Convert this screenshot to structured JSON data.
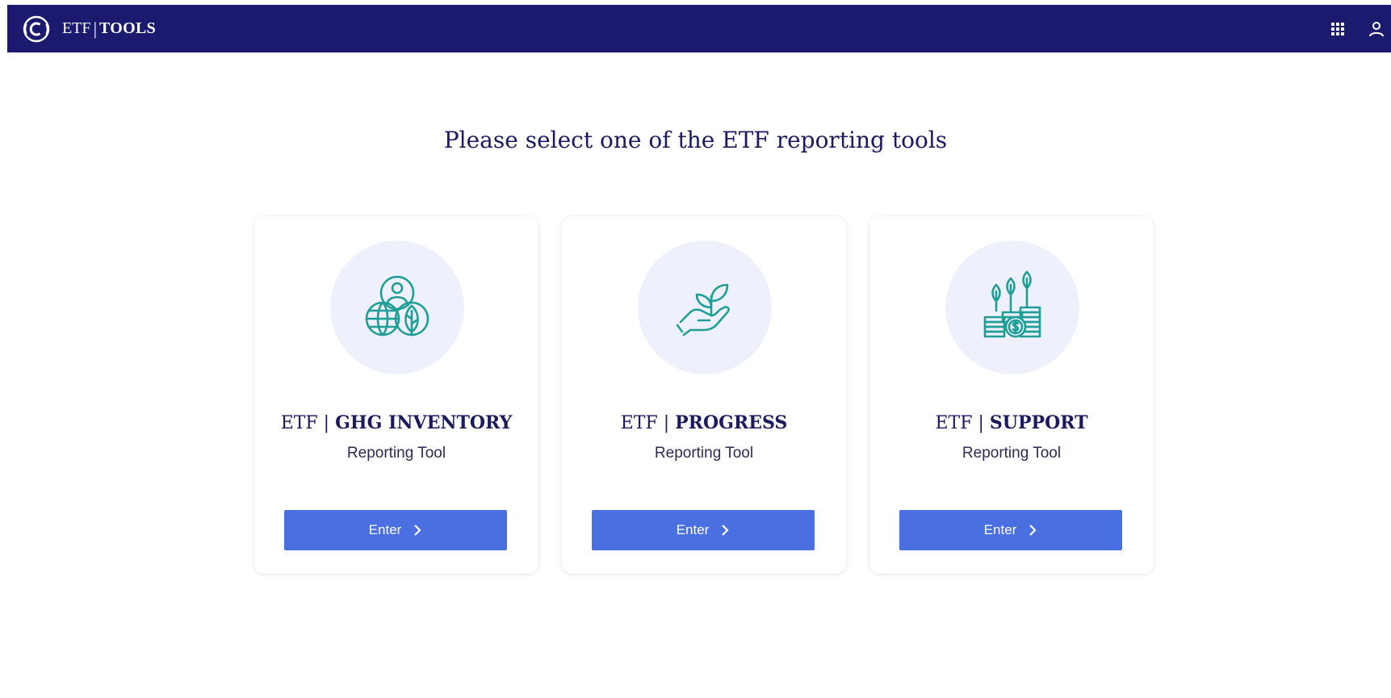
{
  "header": {
    "brand_prefix": "ETF",
    "brand_separator": "|",
    "brand_name": "TOOLS",
    "background": "#1b1a6e",
    "icons": [
      "unfccc-logo-icon",
      "apps-grid-icon",
      "user-account-icon"
    ]
  },
  "main": {
    "headline": "Please select one of the ETF reporting tools",
    "cards": [
      {
        "prefix": "ETF |",
        "name": "GHG INVENTORY",
        "subtitle": "Reporting Tool",
        "button_label": "Enter",
        "icon": "globe-leaf-person-icon"
      },
      {
        "prefix": "ETF |",
        "name": "PROGRESS",
        "subtitle": "Reporting Tool",
        "button_label": "Enter",
        "icon": "hand-seedling-icon"
      },
      {
        "prefix": "ETF |",
        "name": "SUPPORT",
        "subtitle": "Reporting Tool",
        "button_label": "Enter",
        "icon": "coins-plants-icon"
      }
    ]
  },
  "colors": {
    "accent_button": "#4a6fe0",
    "icon_teal": "#1f9e97",
    "icon_circle_bg": "#eef1fb",
    "text_navy": "#1b1a5e"
  }
}
